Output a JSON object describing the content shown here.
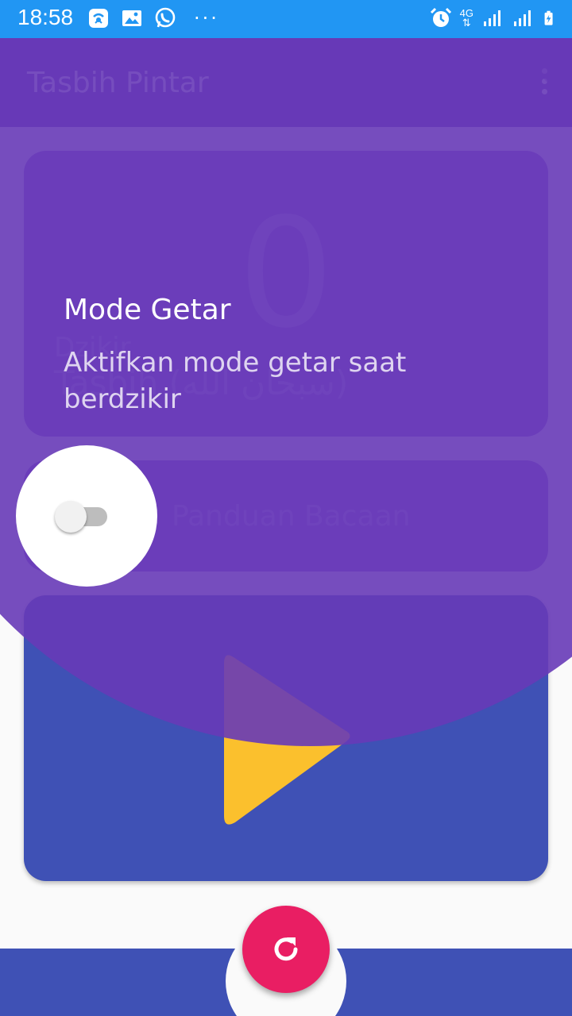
{
  "status_bar": {
    "time": "18:58",
    "network": "4G",
    "left_icons": [
      "wifi-hotspot-icon",
      "image-icon",
      "whatsapp-icon",
      "more-notifications-icon"
    ],
    "right_icons": [
      "alarm-icon",
      "data-arrows-icon",
      "signal-icon",
      "signal-icon",
      "battery-charging-icon"
    ]
  },
  "app_bar": {
    "title": "Tasbih Pintar",
    "menu_icon": "overflow-menu-icon"
  },
  "counter": {
    "value": "0",
    "caption": "Dzikir",
    "label": "Tasbih (سبحان الله)"
  },
  "guide": {
    "label": "Panduan Bacaan"
  },
  "play_card": {
    "icon": "play-icon",
    "accent": "#fbc02d"
  },
  "fab": {
    "icon": "refresh-icon",
    "color": "#e91e63"
  },
  "tutorial": {
    "title": "Mode Getar",
    "description": "Aktifkan mode getar saat berdzikir",
    "toggle_on": false,
    "overlay_color": "#673ab7"
  },
  "colors": {
    "status_bar": "#2196f3",
    "primary": "#673ab7",
    "secondary": "#3f51b5",
    "accent": "#e91e63"
  }
}
